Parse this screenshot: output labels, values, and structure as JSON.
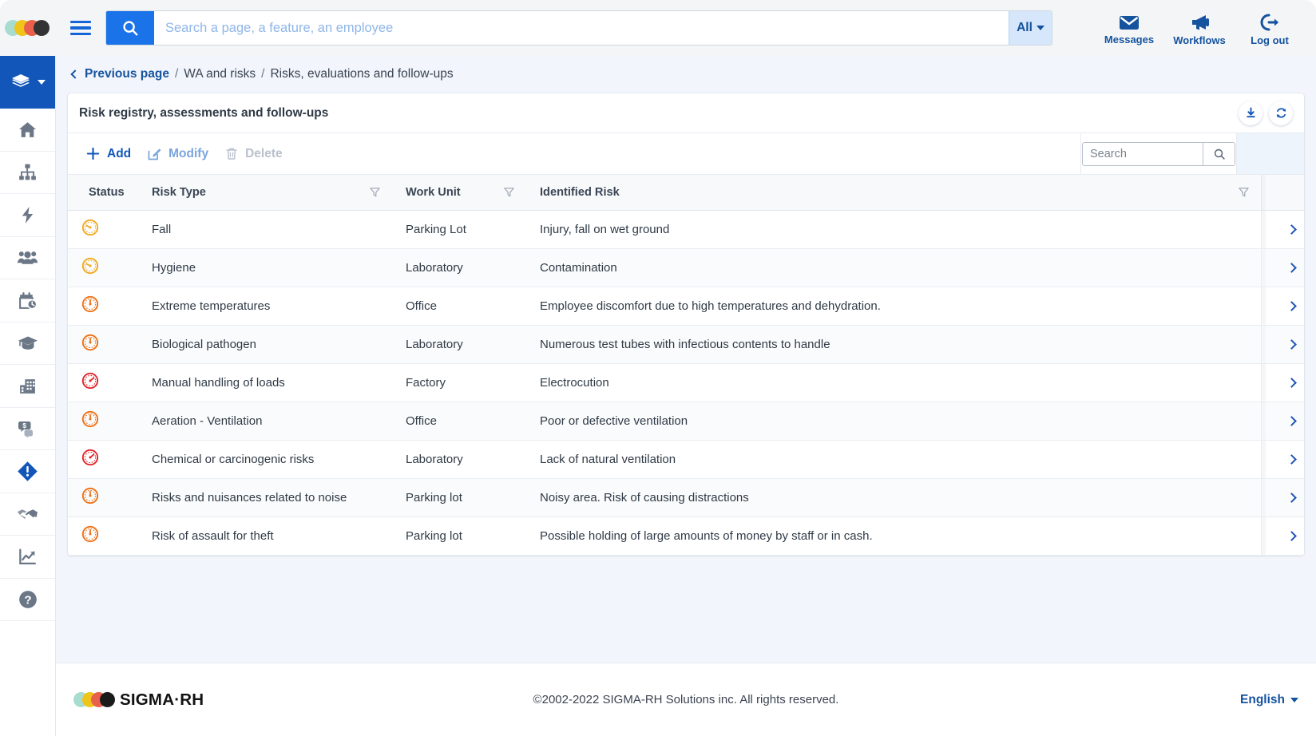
{
  "window": {
    "title": "Risk registry, assessments and follow-ups"
  },
  "topbar": {
    "menu_icon": "hamburger-icon",
    "search": {
      "icon": "search-icon",
      "placeholder": "Search a page, a feature, an employee",
      "value": "",
      "scope_label": "All",
      "scope_caret": "chevron-down-icon"
    },
    "actions": [
      {
        "label": "Messages",
        "icon": "envelope-icon"
      },
      {
        "label": "Workflows",
        "icon": "megaphone-icon"
      },
      {
        "label": "Log out",
        "icon": "logout-icon"
      }
    ]
  },
  "sidebar": {
    "brand": {
      "icon": "layers-icon",
      "caret": "chevron-down-icon"
    },
    "items": [
      {
        "name": "home",
        "icon": "home-icon",
        "active": false
      },
      {
        "name": "organization",
        "icon": "org-chart-icon",
        "active": false
      },
      {
        "name": "actions",
        "icon": "lightning-bolt-icon",
        "active": false
      },
      {
        "name": "employees",
        "icon": "people-icon",
        "active": false
      },
      {
        "name": "time-attendance",
        "icon": "calendar-clock-icon",
        "active": false
      },
      {
        "name": "training",
        "icon": "graduation-cap-icon",
        "active": false
      },
      {
        "name": "company",
        "icon": "building-icon",
        "active": false
      },
      {
        "name": "payroll",
        "icon": "chat-dollar-icon",
        "active": false
      },
      {
        "name": "health-safety",
        "icon": "alert-diamond-icon",
        "active": true
      },
      {
        "name": "labor-relations",
        "icon": "handshake-icon",
        "active": false
      },
      {
        "name": "analytics",
        "icon": "chart-trend-icon",
        "active": false
      },
      {
        "name": "help",
        "icon": "question-circle-icon",
        "active": false
      }
    ]
  },
  "breadcrumb": {
    "back_label": "Previous page",
    "back_icon": "chevron-left-icon",
    "separator": "/",
    "items": [
      "WA and risks",
      "Risks, evaluations and follow-ups"
    ]
  },
  "panel": {
    "title": "Risk registry, assessments and follow-ups",
    "head_actions": [
      {
        "name": "download",
        "icon": "download-icon"
      },
      {
        "name": "refresh",
        "icon": "refresh-icon"
      }
    ],
    "toolbar": {
      "add_label": "Add",
      "add_icon": "plus-icon",
      "modify_label": "Modify",
      "modify_icon": "edit-pencil-icon",
      "delete_label": "Delete",
      "delete_icon": "trash-icon",
      "search_placeholder": "Search",
      "search_value": "",
      "search_icon": "search-icon"
    }
  },
  "table": {
    "columns": [
      {
        "key": "status",
        "label": "Status",
        "filter": false
      },
      {
        "key": "risk_type",
        "label": "Risk Type",
        "filter": true
      },
      {
        "key": "work_unit",
        "label": "Work Unit",
        "filter": true
      },
      {
        "key": "identified_risk",
        "label": "Identified Risk",
        "filter": true
      }
    ],
    "filter_icon": "filter-funnel-icon",
    "row_action_icon": "chevron-right-icon",
    "rows": [
      {
        "status": "yellow",
        "risk_type": "Fall",
        "work_unit": "Parking Lot",
        "identified_risk": "Injury, fall on wet ground"
      },
      {
        "status": "yellow",
        "risk_type": "Hygiene",
        "work_unit": "Laboratory",
        "identified_risk": "Contamination"
      },
      {
        "status": "orange",
        "risk_type": "Extreme temperatures",
        "work_unit": "Office",
        "identified_risk": "Employee discomfort due to high temperatures and dehydration."
      },
      {
        "status": "orange",
        "risk_type": "Biological pathogen",
        "work_unit": "Laboratory",
        "identified_risk": "Numerous test tubes with infectious contents to handle"
      },
      {
        "status": "red",
        "risk_type": "Manual handling of loads",
        "work_unit": "Factory",
        "identified_risk": "Electrocution"
      },
      {
        "status": "orange",
        "risk_type": "Aeration - Ventilation",
        "work_unit": "Office",
        "identified_risk": "Poor or defective ventilation"
      },
      {
        "status": "red",
        "risk_type": "Chemical or carcinogenic risks",
        "work_unit": "Laboratory",
        "identified_risk": "Lack of natural ventilation"
      },
      {
        "status": "orange",
        "risk_type": "Risks and nuisances related to noise",
        "work_unit": "Parking lot",
        "identified_risk": "Noisy area. Risk of causing distractions"
      },
      {
        "status": "orange",
        "risk_type": "Risk of assault for theft",
        "work_unit": "Parking lot",
        "identified_risk": "Possible holding of large amounts of money by staff or in cash."
      }
    ],
    "status_icon_name": "risk-gauge-icon"
  },
  "footer": {
    "logo_text": "SIGMA·RH",
    "copyright": "©2002-2022 SIGMA-RH Solutions inc. All rights reserved.",
    "language": "English",
    "language_caret": "chevron-down-icon"
  },
  "colors": {
    "brand_blue": "#1156b8",
    "accent_blue": "#1a73e8",
    "status_yellow": "#f0a81e",
    "status_orange": "#ef7014",
    "status_red": "#e2242b",
    "page_bg": "#f2f6fc"
  }
}
